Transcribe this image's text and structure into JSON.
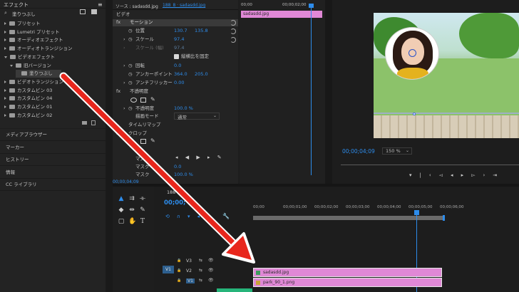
{
  "effects": {
    "title": "エフェクト",
    "search_value": "塗りつぶし",
    "tree": [
      {
        "label": "プリセット",
        "open": false,
        "depth": 0
      },
      {
        "label": "Lumetri プリセット",
        "open": false,
        "depth": 0
      },
      {
        "label": "オーディオエフェクト",
        "open": false,
        "depth": 0
      },
      {
        "label": "オーディオトランジション",
        "open": false,
        "depth": 0
      },
      {
        "label": "ビデオエフェクト",
        "open": true,
        "depth": 0
      },
      {
        "label": "旧バージョン",
        "open": true,
        "depth": 1
      },
      {
        "label": "塗りつぶし",
        "open": false,
        "depth": 2
      },
      {
        "label": "ビデオトランジション",
        "open": false,
        "depth": 0
      },
      {
        "label": "カスタムビン 03",
        "open": false,
        "depth": 0
      },
      {
        "label": "カスタムビン 04",
        "open": false,
        "depth": 0
      },
      {
        "label": "カスタムビン 01",
        "open": false,
        "depth": 0
      },
      {
        "label": "カスタムビン 02",
        "open": false,
        "depth": 0
      }
    ]
  },
  "side_panels": [
    "メディアブラウザー",
    "マーカー",
    "ヒストリー",
    "情報",
    "CC ライブラリ"
  ],
  "effect_controls": {
    "tab_source": "ソース : sadasdd.jpg",
    "tab_sequence": "188_8 · sadasdd.jpg",
    "section": "ビデオ",
    "motion": "モーション",
    "position_label": "位置",
    "position_x": "130.7",
    "position_y": "135.8",
    "scale_label": "スケール",
    "scale_value": "97.4",
    "scale_w_label": "スケール (幅)",
    "scale_w_value": "97.4",
    "uniform_scale": "縦横比を固定",
    "rotation_label": "回転",
    "rotation_value": "0.0",
    "anchor_label": "アンカーポイント",
    "anchor_x": "364.0",
    "anchor_y": "205.0",
    "antiflicker_label": "アンチフリッカー",
    "antiflicker_value": "0.00",
    "opacity_section": "不透明度",
    "opacity_label": "不透明度",
    "opacity_value": "100.0 %",
    "blend_label": "描画モード",
    "blend_value": "通常",
    "time_remap": "タイムリマップ",
    "crop": "クロップ",
    "mask_a": "マスク",
    "mask_b": "マスク",
    "mask_c": "マスク",
    "mask_a_value": "0.0",
    "mask_b_value": "100.0 %",
    "timecode": "00;00;04;09",
    "mini_clip": "sadasdd.jpg",
    "ruler_start": "00;00",
    "ruler_mid": "00;00;02;00"
  },
  "program": {
    "timecode": "00;00;04;09",
    "zoom": "150 %"
  },
  "timeline": {
    "tab": "188",
    "timecode": "00;00;",
    "ruler": [
      "00;00",
      "00;00;01;00",
      "00;00;02;00",
      "00;00;03;00",
      "00;00;04;00",
      "00;00;05;00",
      "00;00;06;00"
    ],
    "tracks": [
      {
        "target": "V1",
        "name": "V3"
      },
      {
        "target": "",
        "name": "V2"
      },
      {
        "target": "",
        "name": "V1"
      }
    ],
    "clips": [
      {
        "name": "sadasdd.jpg"
      },
      {
        "name": "park_90_1.png"
      }
    ]
  },
  "colors": {
    "accent_blue": "#2d8ceb",
    "clip_pink": "#e088d6",
    "arrow_red": "#e8261c"
  }
}
